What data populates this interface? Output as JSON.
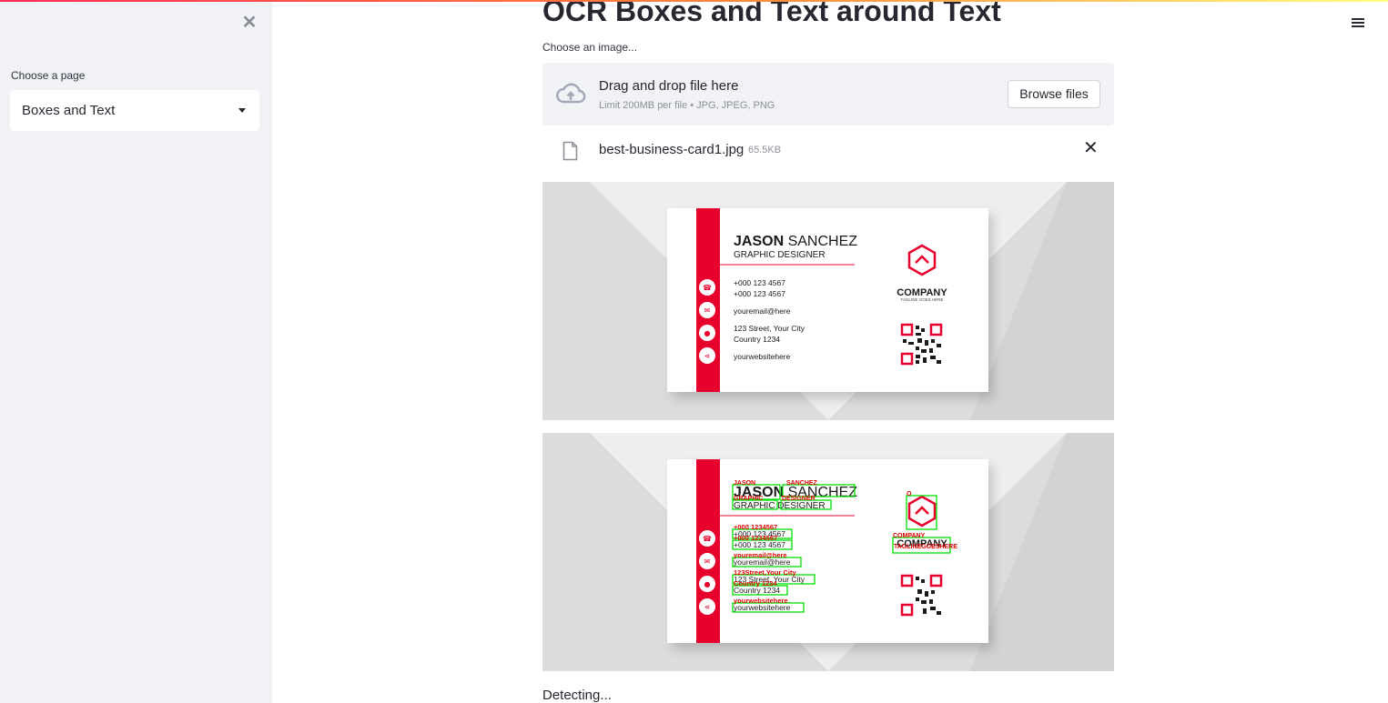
{
  "sidebar": {
    "close_icon": "close-icon",
    "select_label": "Choose a page",
    "select_value": "Boxes and Text"
  },
  "main": {
    "title": "OCR Boxes and Text around Text",
    "uploader": {
      "label": "Choose an image...",
      "drop_text": "Drag and drop file here",
      "limit_text": "Limit 200MB per file • JPG, JPEG, PNG",
      "browse_label": "Browse files"
    },
    "file": {
      "name": "best-business-card1.jpg",
      "size": "65.5KB"
    },
    "status": "Detecting..."
  },
  "card": {
    "first_name": "JASON",
    "last_name": "SANCHEZ",
    "role": "GRAPHIC  DESIGNER",
    "phone1": "+000 123 4567",
    "phone2": "+000 123 4567",
    "email": "youremail@here",
    "address1": "123 Street, Your City",
    "address2": "Country 1234",
    "website": "yourwebsitehere",
    "company": "COMPANY",
    "tagline": "TAGLINE GOES HERE"
  },
  "ocr": {
    "jason": "JASON",
    "sanchez": "SANCHEZ",
    "graphic": "GRAPHIC",
    "designer": "DESIGNER",
    "phone1": "+000 1234567",
    "phone2": "+000 1234567",
    "email": "youremail@here",
    "address": "123Street,Your City",
    "country": "Country 1234",
    "website": "yourwebsitehere",
    "company": "COMPANY",
    "tagline": "TAGLINEGOESHERE",
    "logo": "O"
  },
  "colors": {
    "accent": "#e8002d",
    "ocr_box": "#00e000",
    "ocr_text": "#e00000"
  }
}
